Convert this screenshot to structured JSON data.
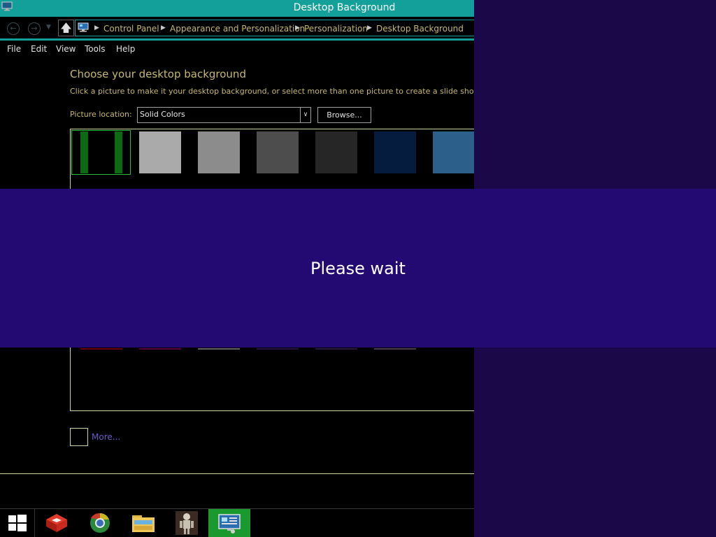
{
  "window": {
    "title": "Desktop Background",
    "icon": "desktop-background-icon"
  },
  "nav": {
    "back_icon": "back-arrow-icon",
    "forward_icon": "forward-arrow-icon",
    "history_icon": "dropdown-caret-icon",
    "up_icon": "up-arrow-icon",
    "breadcrumbs": [
      "Control Panel",
      "Appearance and Personalization",
      "Personalization",
      "Desktop Background"
    ]
  },
  "menu": {
    "items": [
      "File",
      "Edit",
      "View",
      "Tools",
      "Help"
    ]
  },
  "content": {
    "title": "Choose your desktop background",
    "subtitle": "Click a picture to make it your desktop background, or select more than one picture to create a slide show.",
    "location_label": "Picture location:",
    "location_value": "Solid Colors",
    "browse_label": "Browse...",
    "more_label": "More...",
    "tiles": [
      "#000000",
      "#aaaaaa",
      "#8c8c8c",
      "#4d4d4d",
      "#262626",
      "#061c3e",
      "#2c5f8a"
    ],
    "tile_under_colors": [
      "#6a0010",
      "#5a0040",
      "#606060",
      "#2a1040",
      "#2a1840",
      "#4a3a50"
    ]
  },
  "overlay": {
    "text": "Please wait"
  },
  "taskbar": {
    "items": [
      "windows-start-icon",
      "red-cube-app-icon",
      "chrome-browser-icon",
      "file-explorer-icon",
      "mascot-app-icon",
      "control-panel-icon"
    ]
  },
  "colors": {
    "accent": "#14a09a",
    "overlay": "#230a72",
    "desktop": "#1a0848",
    "highlight_text": "#c8b870",
    "active_task": "#1a9a2e"
  }
}
